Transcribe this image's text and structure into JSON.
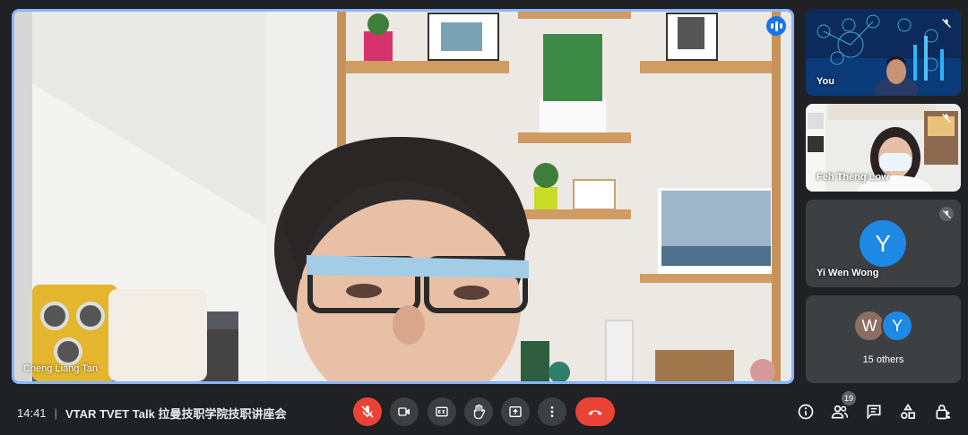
{
  "main": {
    "speaker_name": "Cheng Liang Tan"
  },
  "participants": [
    {
      "name": "You"
    },
    {
      "name": "Feh Theng Low"
    },
    {
      "name": "Yi Wen Wong",
      "initial": "Y"
    }
  ],
  "others": {
    "initials": [
      "W",
      "Y"
    ],
    "label": "15 others",
    "colors": [
      "#8d6e63",
      "#1e88e5"
    ]
  },
  "meeting": {
    "time": "14:41",
    "separator": "|",
    "title": "VTAR TVET Talk 拉曼技职学院技职讲座会"
  },
  "people_count": "19",
  "colors": {
    "accent": "#8ab4f8",
    "danger": "#ea4335",
    "avatar_blue": "#1e88e5"
  }
}
